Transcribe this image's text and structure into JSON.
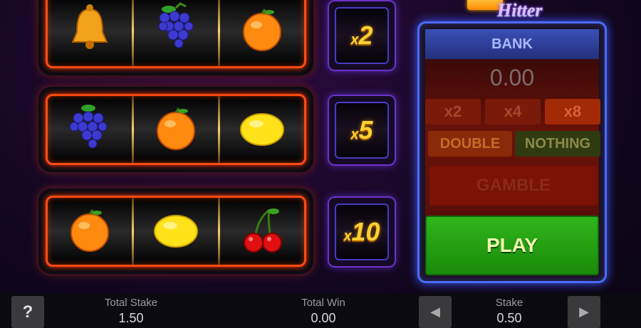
{
  "reels": {
    "row1": [
      "cherry/bell",
      "bell",
      "grapes",
      "orange"
    ],
    "row2": [
      "grapes",
      "orange",
      "lemon"
    ],
    "row3": [
      "orange",
      "lemon",
      "cherry"
    ]
  },
  "multipliers": {
    "m1": {
      "x": "x",
      "value": "2"
    },
    "m2": {
      "x": "x",
      "value": "5"
    },
    "m3": {
      "x": "x",
      "value": "10"
    }
  },
  "logo": {
    "sub": "Hitter"
  },
  "bank": {
    "title": "BANK",
    "value": "0.00",
    "x2": "x2",
    "x4": "x4",
    "x8": "x8",
    "double": "DOUBLE",
    "nothing": "NOTHING",
    "gamble": "GAMBLE",
    "play": "PLAY"
  },
  "footer": {
    "help": "?",
    "total_stake_label": "Total Stake",
    "total_stake_value": "1.50",
    "total_win_label": "Total Win",
    "total_win_value": "0.00",
    "stake_label": "Stake",
    "stake_value": "0.50"
  },
  "colors": {
    "accent_blue": "#4b6cff",
    "play_green": "#2fb61a",
    "reel_frame": "#ff4a14"
  }
}
